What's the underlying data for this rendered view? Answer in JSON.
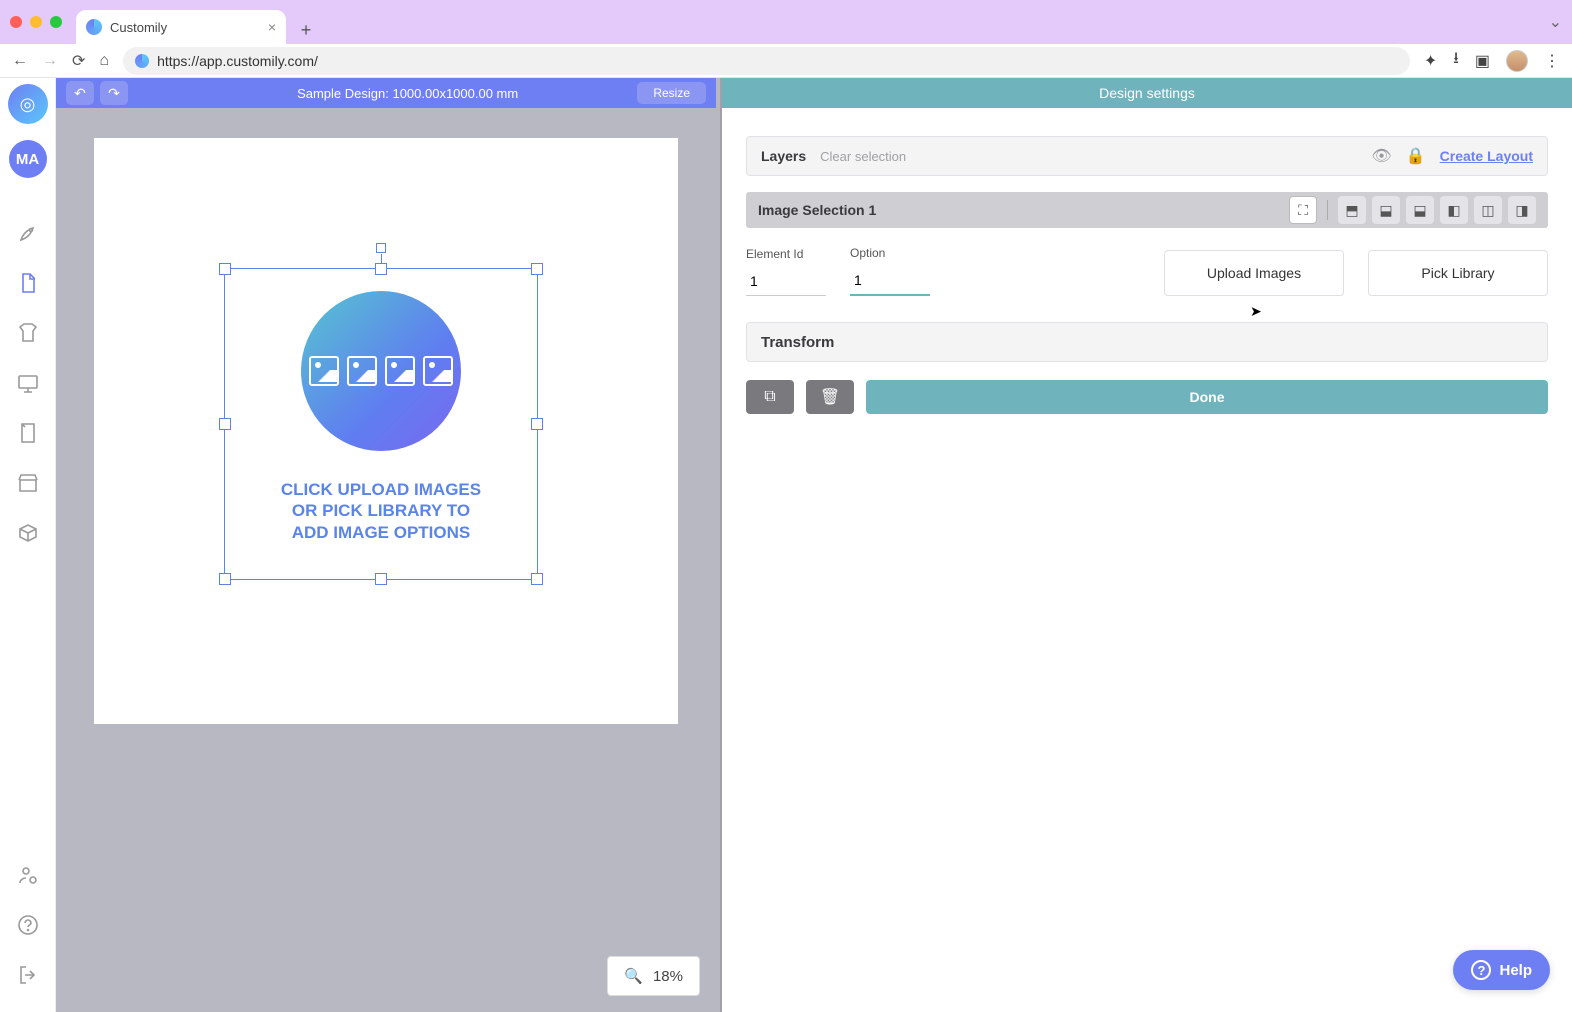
{
  "browser": {
    "tab_title": "Customily",
    "url": "https://app.customily.com/"
  },
  "user": {
    "avatar_initials": "MA"
  },
  "canvas": {
    "title": "Sample Design: 1000.00x1000.00 mm",
    "resize_label": "Resize",
    "zoom": "18%",
    "placeholder_line1": "CLICK UPLOAD IMAGES",
    "placeholder_line2": "OR PICK LIBRARY TO",
    "placeholder_line3": "ADD IMAGE OPTIONS"
  },
  "panel": {
    "title": "Design settings",
    "layers_label": "Layers",
    "clear_selection": "Clear selection",
    "create_layout": "Create Layout",
    "selected_layer": "Image Selection 1",
    "element_id_label": "Element Id",
    "element_id_value": "1",
    "option_label": "Option",
    "option_value": "1",
    "upload_images": "Upload Images",
    "pick_library": "Pick Library",
    "transform_label": "Transform",
    "done_label": "Done"
  },
  "help": {
    "label": "Help"
  }
}
